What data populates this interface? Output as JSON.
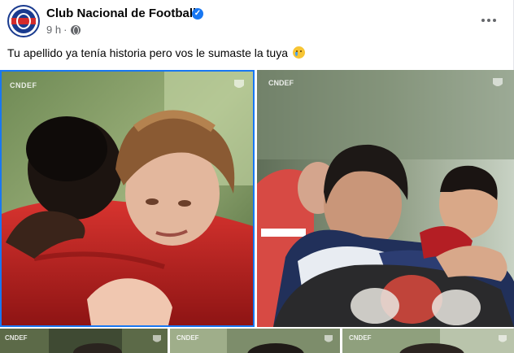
{
  "post": {
    "page_name": "Club Nacional de Football",
    "time": "9 h",
    "separator": "·",
    "caption": "Tu apellido ya tenía historia pero vos le sumaste la tuya",
    "verified_mark": "✓"
  },
  "photos": [
    {
      "watermark": "CNDEF"
    },
    {
      "watermark": "CNDEF"
    },
    {
      "watermark": "CNDEF"
    },
    {
      "watermark": "CNDEF"
    },
    {
      "watermark": "CNDEF"
    }
  ],
  "icons": {
    "avatar": "club-crest",
    "verified": "verified-badge-icon",
    "audience": "globe-icon",
    "more": "more-options-icon",
    "emoji": "crying-face-emoji"
  },
  "colors": {
    "accent": "#1877f2",
    "club_blue": "#1a3b8f",
    "club_red": "#d42b2b",
    "secondary_text": "#65676b"
  }
}
